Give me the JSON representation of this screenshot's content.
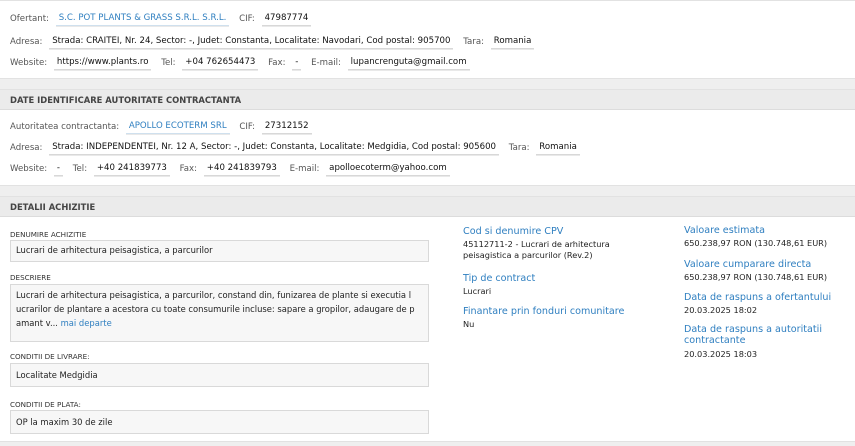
{
  "ofertant": {
    "ofertant_label": "Ofertant:",
    "ofertant_value": "S.C. POT PLANTS & GRASS S.R.L. S.R.L.",
    "cif_label": "CIF:",
    "cif_value": "47987774",
    "adresa_label": "Adresa:",
    "adresa_value": "Strada: CRAITEI, Nr. 24, Sector: -, Judet: Constanta, Localitate: Navodari, Cod postal: 905700",
    "tara_label": "Tara:",
    "tara_value": "Romania",
    "website_label": "Website:",
    "website_value": "https://www.plants.ro",
    "tel_label": "Tel:",
    "tel_value": "+04 762654473",
    "fax_label": "Fax:",
    "fax_value": "-",
    "email_label": "E-mail:",
    "email_value": "lupancrenguta@gmail.com"
  },
  "autoritate": {
    "header": "DATE IDENTIFICARE AUTORITATE CONTRACTANTA",
    "autoritate_label": "Autoritatea contractanta:",
    "autoritate_value": "APOLLO ECOTERM SRL",
    "cif_label": "CIF:",
    "cif_value": "27312152",
    "adresa_label": "Adresa:",
    "adresa_value": "Strada: INDEPENDENTEI, Nr. 12 A, Sector: -, Judet: Constanta, Localitate: Medgidia, Cod postal: 905600",
    "tara_label": "Tara:",
    "tara_value": "Romania",
    "website_label": "Website:",
    "website_value": "-",
    "tel_label": "Tel:",
    "tel_value": "+40 241839773",
    "fax_label": "Fax:",
    "fax_value": "+40 241839793",
    "email_label": "E-mail:",
    "email_value": "apolloecoterm@yahoo.com"
  },
  "achizitie": {
    "header": "DETALII ACHIZITIE",
    "denumire_label": "DENUMIRE ACHIZITIE",
    "denumire_value": "Lucrari de arhitectura peisagistica, a parcurilor",
    "descriere_label": "DESCRIERE",
    "descriere_value": "Lucrari de arhitectura peisagistica, a parcurilor, constand din, funizarea de plante si executia l ucrarilor de plantare a acestora cu toate consumurile incluse: sapare a gropilor, adaugare de p amant v...",
    "mai_departe": "mai departe",
    "livrare_label": "CONDITII DE LIVRARE:",
    "livrare_value": "Localitate Medgidia",
    "plata_label": "CONDITII DE PLATA:",
    "plata_value": "OP la maxim 30 de zile",
    "cpv_title": "Cod si denumire CPV",
    "cpv_value": "45112711-2 - Lucrari de arhitectura peisagistica a parcurilor (Rev.2)",
    "tip_title": "Tip de contract",
    "tip_value": "Lucrari",
    "finantare_title": "Finantare prin fonduri comunitare",
    "finantare_value": "Nu",
    "val_estimata_title": "Valoare estimata",
    "val_estimata_value": "650.238,97 RON (130.748,61 EUR)",
    "val_directa_title": "Valoare cumparare directa",
    "val_directa_value": "650.238,97 RON (130.748,61 EUR)",
    "raspuns_ofertant_title": "Data de raspuns a ofertantului",
    "raspuns_ofertant_value": "20.03.2025 18:02",
    "raspuns_autoritate_title": "Data de raspuns a autoritatii contractante",
    "raspuns_autoritate_value": "20.03.2025 18:03"
  }
}
